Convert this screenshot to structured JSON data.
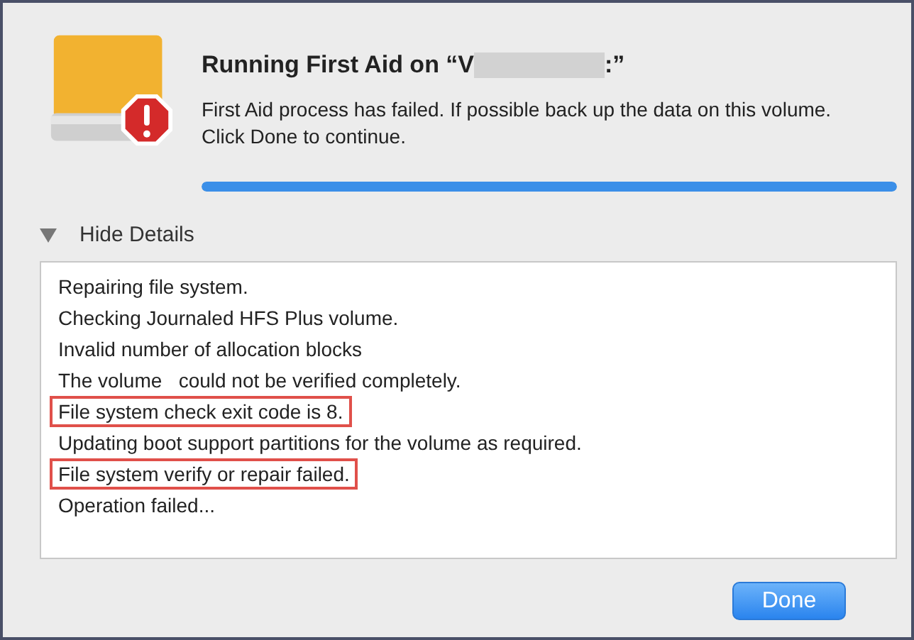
{
  "dialog": {
    "title": "Running First Aid on “V",
    "title_end": ":”",
    "message": "First Aid process has failed. If possible back up the data on this volume. Click Done to continue.",
    "progress": {
      "level": 1
    }
  },
  "details": {
    "toggle": "Hide Details",
    "expanded": true,
    "log": [
      {
        "text": "Repairing file system.",
        "highlighted": false
      },
      {
        "text": "Checking Journaled HFS Plus volume.",
        "highlighted": false
      },
      {
        "text": "Invalid number of allocation blocks",
        "highlighted": false
      },
      {
        "text": "The volume   could not be verified completely.",
        "highlighted": false
      },
      {
        "text": "File system check exit code is 8.",
        "highlighted": true
      },
      {
        "text": "Updating boot support partitions for the volume as required.",
        "highlighted": false
      },
      {
        "text": "File system verify or repair failed.",
        "highlighted": true
      },
      {
        "text": "Operation failed...",
        "highlighted": false
      }
    ]
  },
  "buttons": [
    {
      "label": "Done"
    }
  ]
}
